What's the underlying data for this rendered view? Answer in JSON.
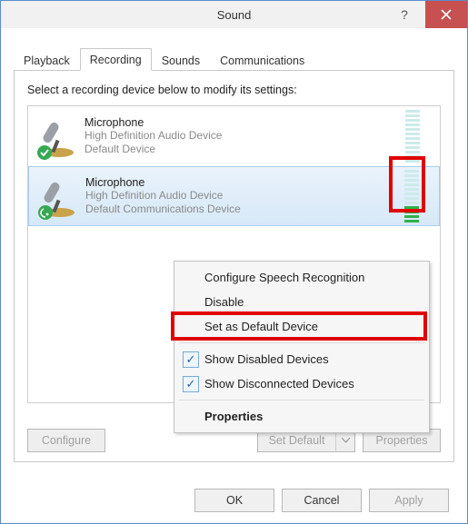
{
  "window": {
    "title": "Sound"
  },
  "tabs": {
    "playback": "Playback",
    "recording": "Recording",
    "sounds": "Sounds",
    "communications": "Communications",
    "active": "recording"
  },
  "instruction": "Select a recording device below to modify its settings:",
  "devices": [
    {
      "name": "Microphone",
      "desc1": "High Definition Audio Device",
      "desc2": "Default Device",
      "badge": "check",
      "meter_on": 0,
      "selected": false
    },
    {
      "name": "Microphone",
      "desc1": "High Definition Audio Device",
      "desc2": "Default Communications Device",
      "badge": "phone",
      "meter_on": 4,
      "selected": true
    }
  ],
  "context_menu": {
    "configure": "Configure Speech Recognition",
    "disable": "Disable",
    "set_default": "Set as Default Device",
    "show_disabled": "Show Disabled Devices",
    "show_disconnected": "Show Disconnected Devices",
    "properties": "Properties",
    "show_disabled_checked": true,
    "show_disconnected_checked": true
  },
  "buttons": {
    "configure": "Configure",
    "set_default": "Set Default",
    "properties": "Properties",
    "ok": "OK",
    "cancel": "Cancel",
    "apply": "Apply"
  },
  "icons": {
    "mic": "microphone-icon",
    "check_badge": "check-badge-icon",
    "phone_badge": "phone-badge-icon"
  }
}
